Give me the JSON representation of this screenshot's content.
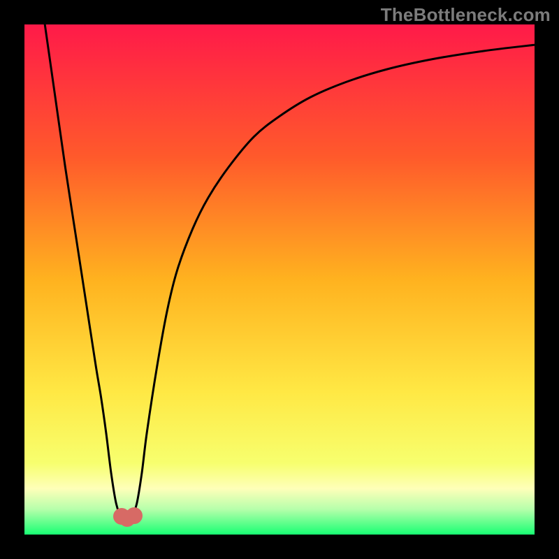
{
  "watermark": "TheBottleneck.com",
  "colors": {
    "frame": "#000000",
    "gradient_top": "#ff1a49",
    "gradient_mid1": "#ff5a2b",
    "gradient_mid2": "#ffb21f",
    "gradient_mid3": "#ffe844",
    "gradient_mid4": "#f7ff6e",
    "gradient_band_yellow": "#feffb9",
    "gradient_band_lightgreen": "#b7ffab",
    "gradient_bottom": "#18ff73",
    "curve": "#000000",
    "marker": "#d76a65"
  },
  "chart_data": {
    "type": "line",
    "title": "",
    "xlabel": "",
    "ylabel": "",
    "xlim": [
      0,
      100
    ],
    "ylim": [
      0,
      100
    ],
    "series": [
      {
        "name": "bottleneck-curve",
        "x": [
          4,
          6,
          8,
          10,
          12,
          14,
          15,
          16,
          17,
          18,
          19,
          20,
          21,
          22,
          23,
          24,
          26,
          28,
          30,
          33,
          36,
          40,
          45,
          50,
          56,
          63,
          71,
          80,
          90,
          100
        ],
        "values": [
          100,
          86,
          72,
          59,
          46,
          33,
          27,
          20,
          12,
          6,
          3.5,
          3.2,
          3.5,
          6,
          12,
          20,
          33,
          44,
          52,
          60,
          66,
          72,
          78,
          82,
          85.7,
          88.7,
          91.2,
          93.2,
          94.8,
          96
        ]
      }
    ],
    "markers": [
      {
        "x": 19,
        "y": 3.5
      },
      {
        "x": 20.2,
        "y": 3.1
      },
      {
        "x": 21.5,
        "y": 3.7
      }
    ]
  }
}
